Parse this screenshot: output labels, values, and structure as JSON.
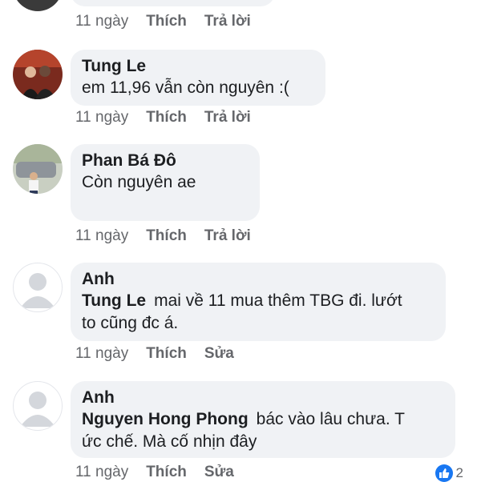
{
  "top_comment": {
    "time": "11 ngày",
    "like_label": "Thích",
    "reply_label": "Trả lời"
  },
  "comments": [
    {
      "author": "Tung Le",
      "mention": "",
      "text": "em 11,96 vẫn còn nguyên :(",
      "time": "11 ngày",
      "like_label": "Thích",
      "second_action": "Trả lời",
      "avatar": "photo-avatar"
    },
    {
      "author": "Phan Bá Đô",
      "mention": "",
      "text": "Còn nguyên ae",
      "time": "11 ngày",
      "like_label": "Thích",
      "second_action": "Trả lời",
      "avatar": "photo-avatar"
    },
    {
      "author": "Anh",
      "mention": "Tung Le",
      "text_line1": "mai về 11 mua thêm TBG đi. lướt",
      "text_line2": "to cũng đc á.",
      "time": "11 ngày",
      "like_label": "Thích",
      "second_action": "Sửa",
      "avatar": "default-avatar"
    },
    {
      "author": "Anh",
      "mention": "Nguyen Hong Phong",
      "text_line1": "bác vào lâu chưa. T",
      "text_line2": "ức chế. Mà cố nhịn đây",
      "time": "11 ngày",
      "like_label": "Thích",
      "second_action": "Sửa",
      "avatar": "default-avatar",
      "reaction_count": "2",
      "reaction_icon": "like-icon"
    }
  ],
  "colors": {
    "bubble": "#f0f2f5",
    "meta_text": "#65676b",
    "like_blue": "#1877f2"
  }
}
